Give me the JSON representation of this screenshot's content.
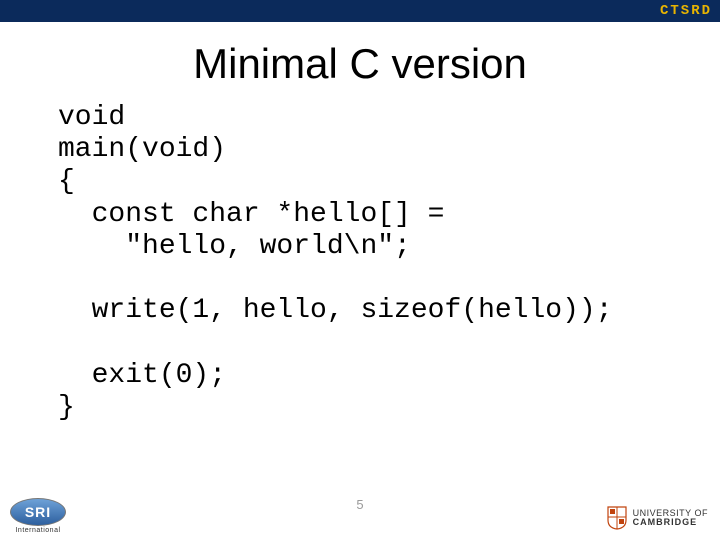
{
  "topbar": {
    "label": "CTSRD"
  },
  "title": "Minimal C version",
  "code": "void\nmain(void)\n{\n  const char *hello[] =\n    \"hello, world\\n\";\n\n  write(1, hello, sizeof(hello));\n\n  exit(0);\n}",
  "page_number": "5",
  "logos": {
    "sri": {
      "text": "SRI",
      "sub": "International"
    },
    "cambridge": {
      "line1": "UNIVERSITY OF",
      "line2": "CAMBRIDGE"
    }
  }
}
